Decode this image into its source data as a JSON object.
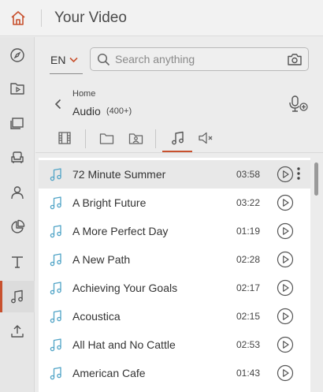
{
  "app": {
    "title": "Your Video"
  },
  "colors": {
    "accent": "#c8512e",
    "note_icon": "#4fa3c6"
  },
  "language": {
    "value": "EN"
  },
  "search": {
    "placeholder": "Search anything",
    "value": ""
  },
  "breadcrumb": {
    "home": "Home",
    "title": "Audio",
    "count": "(400+)"
  },
  "rail_icons": [
    "compass-icon",
    "media-folder-icon",
    "layers-icon",
    "armchair-icon",
    "person-icon",
    "pie-chart-icon",
    "text-icon",
    "music-icon",
    "upload-icon"
  ],
  "rail_active": "music-icon",
  "tabs": [
    "film-icon",
    "folder-icon",
    "image-folder-icon",
    "music-icon",
    "sound-effects-icon"
  ],
  "active_tab": "music-icon",
  "tracks": [
    {
      "title": "72 Minute Summer",
      "duration": "03:58"
    },
    {
      "title": "A Bright Future",
      "duration": "03:22"
    },
    {
      "title": "A More Perfect Day",
      "duration": "01:19"
    },
    {
      "title": "A New Path",
      "duration": "02:28"
    },
    {
      "title": "Achieving Your Goals",
      "duration": "02:17"
    },
    {
      "title": "Acoustica",
      "duration": "02:15"
    },
    {
      "title": "All Hat and No Cattle",
      "duration": "02:53"
    },
    {
      "title": "American Cafe",
      "duration": "01:43"
    }
  ]
}
